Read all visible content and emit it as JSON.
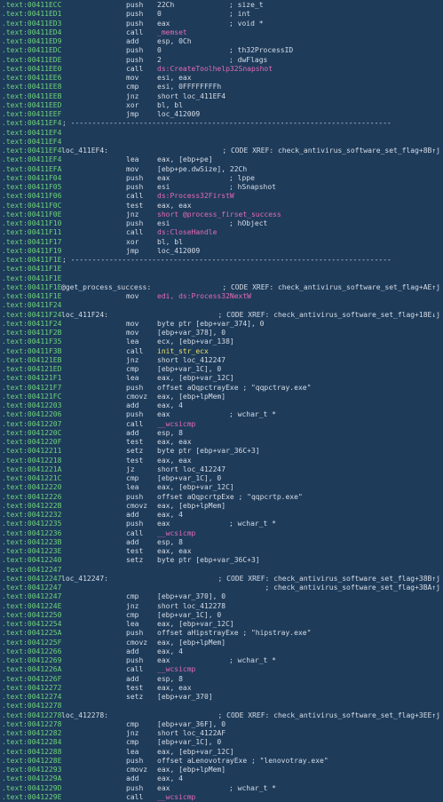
{
  "colors": {
    "background": "#1e3b5a",
    "address": "#6fd57b",
    "text": "#d6dde6",
    "api_symbol": "#e46bb4",
    "user_function": "#e9e06a"
  },
  "rows": [
    {
      "a": ".text:00411ECC",
      "m": "push",
      "o": "22Ch",
      "c": "; size_t"
    },
    {
      "a": ".text:00411ED1",
      "m": "push",
      "o": "0",
      "c": "; int"
    },
    {
      "a": ".text:00411ED3",
      "m": "push",
      "o": "eax",
      "c": "; void *"
    },
    {
      "a": ".text:00411ED4",
      "m": "call",
      "o": "_memset",
      "oc": "fn"
    },
    {
      "a": ".text:00411ED9",
      "m": "add",
      "o": "esp, 0Ch"
    },
    {
      "a": ".text:00411EDC",
      "m": "push",
      "o": "0",
      "c": "; th32ProcessID"
    },
    {
      "a": ".text:00411EDE",
      "m": "push",
      "o": "2",
      "c": "; dwFlags"
    },
    {
      "a": ".text:00411EE0",
      "m": "call",
      "o": "ds:CreateToolhelp32Snapshot",
      "oc": "fn"
    },
    {
      "a": ".text:00411EE6",
      "m": "mov",
      "o": "esi, eax"
    },
    {
      "a": ".text:00411EE8",
      "m": "cmp",
      "o": "esi, 0FFFFFFFFh"
    },
    {
      "a": ".text:00411EEB",
      "m": "jnz",
      "o": "short loc_411EF4"
    },
    {
      "a": ".text:00411EED",
      "m": "xor",
      "o": "bl, bl"
    },
    {
      "a": ".text:00411EEF",
      "m": "jmp",
      "o": "loc_412009"
    },
    {
      "a": ".text:00411EF4",
      "sep": "; ---------------------------------------------------------------------------"
    },
    {
      "a": ".text:00411EF4"
    },
    {
      "a": ".text:00411EF4"
    },
    {
      "a": ".text:00411EF4",
      "l": "loc_411EF4:",
      "r": "; CODE XREF: check_antivirus_software_set_flag+8B↑j"
    },
    {
      "a": ".text:00411EF4",
      "m": "lea",
      "o": "eax, [ebp+pe]"
    },
    {
      "a": ".text:00411EFA",
      "m": "mov",
      "o": "[ebp+pe.dwSize], 22Ch"
    },
    {
      "a": ".text:00411F04",
      "m": "push",
      "o": "eax",
      "c": "; lppe"
    },
    {
      "a": ".text:00411F05",
      "m": "push",
      "o": "esi",
      "c": "; hSnapshot"
    },
    {
      "a": ".text:00411F06",
      "m": "call",
      "o": "ds:Process32FirstW",
      "oc": "fn"
    },
    {
      "a": ".text:00411F0C",
      "m": "test",
      "o": "eax, eax"
    },
    {
      "a": ".text:00411F0E",
      "m": "jnz",
      "o": "short @process_firset_success",
      "oc": "sym"
    },
    {
      "a": ".text:00411F10",
      "m": "push",
      "o": "esi",
      "c": "; hObject"
    },
    {
      "a": ".text:00411F11",
      "m": "call",
      "o": "ds:CloseHandle",
      "oc": "fn"
    },
    {
      "a": ".text:00411F17",
      "m": "xor",
      "o": "bl, bl"
    },
    {
      "a": ".text:00411F19",
      "m": "jmp",
      "o": "loc_412009"
    },
    {
      "a": ".text:00411F1E",
      "sep": "; ---------------------------------------------------------------------------"
    },
    {
      "a": ".text:00411F1E"
    },
    {
      "a": ".text:00411F1E"
    },
    {
      "a": ".text:00411F1E",
      "l": "@get_process_success:",
      "r": "; CODE XREF: check_antivirus_software_set_flag+AE↑j"
    },
    {
      "a": ".text:00411F1E",
      "m": "mov",
      "o": "edi, ds:Process32NextW",
      "oc": "fn"
    },
    {
      "a": ".text:00411F24"
    },
    {
      "a": ".text:00411F24",
      "l": "loc_411F24:",
      "r": "; CODE XREF: check_antivirus_software_set_flag+18E↓j"
    },
    {
      "a": ".text:00411F24",
      "m": "mov",
      "o": "byte ptr [ebp+var_374], 0"
    },
    {
      "a": ".text:00411F2B",
      "m": "mov",
      "o": "[ebp+var_378], 0"
    },
    {
      "a": ".text:00411F35",
      "m": "lea",
      "o": "ecx, [ebp+var_138]"
    },
    {
      "a": ".text:00411F3B",
      "m": "call",
      "o": "init_str_ecx",
      "oc": "init"
    },
    {
      "a": ".text:004121EB",
      "m": "jnz",
      "o": "short loc_412247"
    },
    {
      "a": ".text:004121ED",
      "m": "cmp",
      "o": "[ebp+var_1C], 0"
    },
    {
      "a": ".text:004121F1",
      "m": "lea",
      "o": "eax, [ebp+var_12C]"
    },
    {
      "a": ".text:004121F7",
      "m": "push",
      "o": "offset aQqpctrayExe ; \"qqpctray.exe\""
    },
    {
      "a": ".text:004121FC",
      "m": "cmovz",
      "o": "eax, [ebp+lpMem]"
    },
    {
      "a": ".text:00412203",
      "m": "add",
      "o": "eax, 4"
    },
    {
      "a": ".text:00412206",
      "m": "push",
      "o": "eax",
      "c": "; wchar_t *"
    },
    {
      "a": ".text:00412207",
      "m": "call",
      "o": "__wcsicmp",
      "oc": "fn"
    },
    {
      "a": ".text:0041220C",
      "m": "add",
      "o": "esp, 8"
    },
    {
      "a": ".text:0041220F",
      "m": "test",
      "o": "eax, eax"
    },
    {
      "a": ".text:00412211",
      "m": "setz",
      "o": "byte ptr [ebp+var_36C+3]"
    },
    {
      "a": ".text:00412218",
      "m": "test",
      "o": "eax, eax"
    },
    {
      "a": ".text:0041221A",
      "m": "jz",
      "o": "short loc_412247"
    },
    {
      "a": ".text:0041221C",
      "m": "cmp",
      "o": "[ebp+var_1C], 0"
    },
    {
      "a": ".text:00412220",
      "m": "lea",
      "o": "eax, [ebp+var_12C]"
    },
    {
      "a": ".text:00412226",
      "m": "push",
      "o": "offset aQqpcrtpExe ; \"qqpcrtp.exe\""
    },
    {
      "a": ".text:0041222B",
      "m": "cmovz",
      "o": "eax, [ebp+lpMem]"
    },
    {
      "a": ".text:00412232",
      "m": "add",
      "o": "eax, 4"
    },
    {
      "a": ".text:00412235",
      "m": "push",
      "o": "eax",
      "c": "; wchar_t *"
    },
    {
      "a": ".text:00412236",
      "m": "call",
      "o": "__wcsicmp",
      "oc": "fn"
    },
    {
      "a": ".text:0041223B",
      "m": "add",
      "o": "esp, 8"
    },
    {
      "a": ".text:0041223E",
      "m": "test",
      "o": "eax, eax"
    },
    {
      "a": ".text:00412240",
      "m": "setz",
      "o": "byte ptr [ebp+var_36C+3]"
    },
    {
      "a": ".text:00412247"
    },
    {
      "a": ".text:00412247",
      "l": "loc_412247:",
      "r": "; CODE XREF: check_antivirus_software_set_flag+38B↑j"
    },
    {
      "a": ".text:00412247",
      "r": "; check_antivirus_software_set_flag+3BA↑j"
    },
    {
      "a": ".text:00412247",
      "m": "cmp",
      "o": "[ebp+var_370], 0"
    },
    {
      "a": ".text:0041224E",
      "m": "jnz",
      "o": "short loc_412278"
    },
    {
      "a": ".text:00412250",
      "m": "cmp",
      "o": "[ebp+var_1C], 0"
    },
    {
      "a": ".text:00412254",
      "m": "lea",
      "o": "eax, [ebp+var_12C]"
    },
    {
      "a": ".text:0041225A",
      "m": "push",
      "o": "offset aHipstrayExe ; \"hipstray.exe\""
    },
    {
      "a": ".text:0041225F",
      "m": "cmovz",
      "o": "eax, [ebp+lpMem]"
    },
    {
      "a": ".text:00412266",
      "m": "add",
      "o": "eax, 4"
    },
    {
      "a": ".text:00412269",
      "m": "push",
      "o": "eax",
      "c": "; wchar_t *"
    },
    {
      "a": ".text:0041226A",
      "m": "call",
      "o": "__wcsicmp",
      "oc": "fn"
    },
    {
      "a": ".text:0041226F",
      "m": "add",
      "o": "esp, 8"
    },
    {
      "a": ".text:00412272",
      "m": "test",
      "o": "eax, eax"
    },
    {
      "a": ".text:00412274",
      "m": "setz",
      "o": "[ebp+var_370]"
    },
    {
      "a": ".text:00412278"
    },
    {
      "a": ".text:00412278",
      "l": "loc_412278:",
      "r": "; CODE XREF: check_antivirus_software_set_flag+3EE↑j"
    },
    {
      "a": ".text:00412278",
      "m": "cmp",
      "o": "[ebp+var_36F], 0"
    },
    {
      "a": ".text:00412282",
      "m": "jnz",
      "o": "short loc_4122AF"
    },
    {
      "a": ".text:00412284",
      "m": "cmp",
      "o": "[ebp+var_1C], 0"
    },
    {
      "a": ".text:00412288",
      "m": "lea",
      "o": "eax, [ebp+var_12C]"
    },
    {
      "a": ".text:0041228E",
      "m": "push",
      "o": "offset aLenovotrayExe ; \"lenovotray.exe\""
    },
    {
      "a": ".text:00412293",
      "m": "cmovz",
      "o": "eax, [ebp+lpMem]"
    },
    {
      "a": ".text:0041229A",
      "m": "add",
      "o": "eax, 4"
    },
    {
      "a": ".text:0041229D",
      "m": "push",
      "o": "eax",
      "c": "; wchar_t *"
    },
    {
      "a": ".text:0041229E",
      "m": "call",
      "o": "__wcsicmp",
      "oc": "fn"
    }
  ]
}
